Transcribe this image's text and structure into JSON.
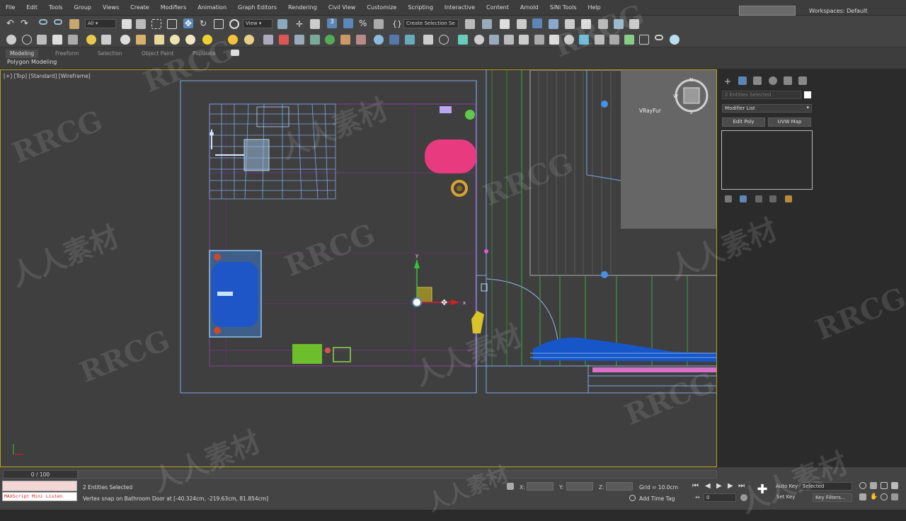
{
  "menubar": {
    "items": [
      "File",
      "Edit",
      "Tools",
      "Group",
      "Views",
      "Create",
      "Modifiers",
      "Animation",
      "Graph Editors",
      "Rendering",
      "Civil View",
      "Customize",
      "Scripting",
      "Interactive",
      "Content",
      "Arnold",
      "SiNi Tools",
      "Help"
    ],
    "workspace_label": "Workspaces:",
    "workspace_value": "Default"
  },
  "toolbar": {
    "filter_value": "All",
    "view_value": "View",
    "selection_set": "Create Selection Se"
  },
  "ribbon": {
    "tabs": [
      "Modeling",
      "Freeform",
      "Selection",
      "Object Paint",
      "Populate"
    ],
    "active_tab": "Modeling",
    "sub_label": "Polygon Modeling"
  },
  "viewport": {
    "label": "[+] [Top] [Standard] [Wireframe]",
    "object_label": "VRayFur",
    "gizmo_axis_x": "x",
    "gizmo_axis_y": "y",
    "compass": {
      "n": "N",
      "w": "W",
      "s": "S"
    }
  },
  "command_panel": {
    "selection_field": "2 Entities Selected",
    "modifier_list": "Modifier List",
    "buttons": [
      "Edit Poly",
      "UVW Map"
    ]
  },
  "timeline": {
    "frame_range": "0 / 100"
  },
  "status": {
    "maxscript": "MAXScript Mini Listen",
    "selection_text": "2 Entities Selected",
    "prompt_text": "Vertex snap on Bathroom Door at [-40.324cm, -219.63cm, 81.854cm]",
    "x_label": "X:",
    "y_label": "Y:",
    "z_label": "Z:",
    "grid": "Grid = 10.0cm",
    "add_time_tag": "Add Time Tag",
    "frame_value": "0",
    "auto_key": "Auto Key",
    "selected_dropdown": "Selected",
    "set_key": "Set Key",
    "key_filters": "Key Filters..."
  },
  "watermark": {
    "latin": "RRCG",
    "cjk": "人人素材"
  },
  "colors": {
    "viewport_border": "#b7a020",
    "selection_blue": "#5b86b5",
    "wire_blue": "#7ea8e8",
    "wall_purple": "#7b3f8a",
    "grid_green": "#3aa84a"
  }
}
